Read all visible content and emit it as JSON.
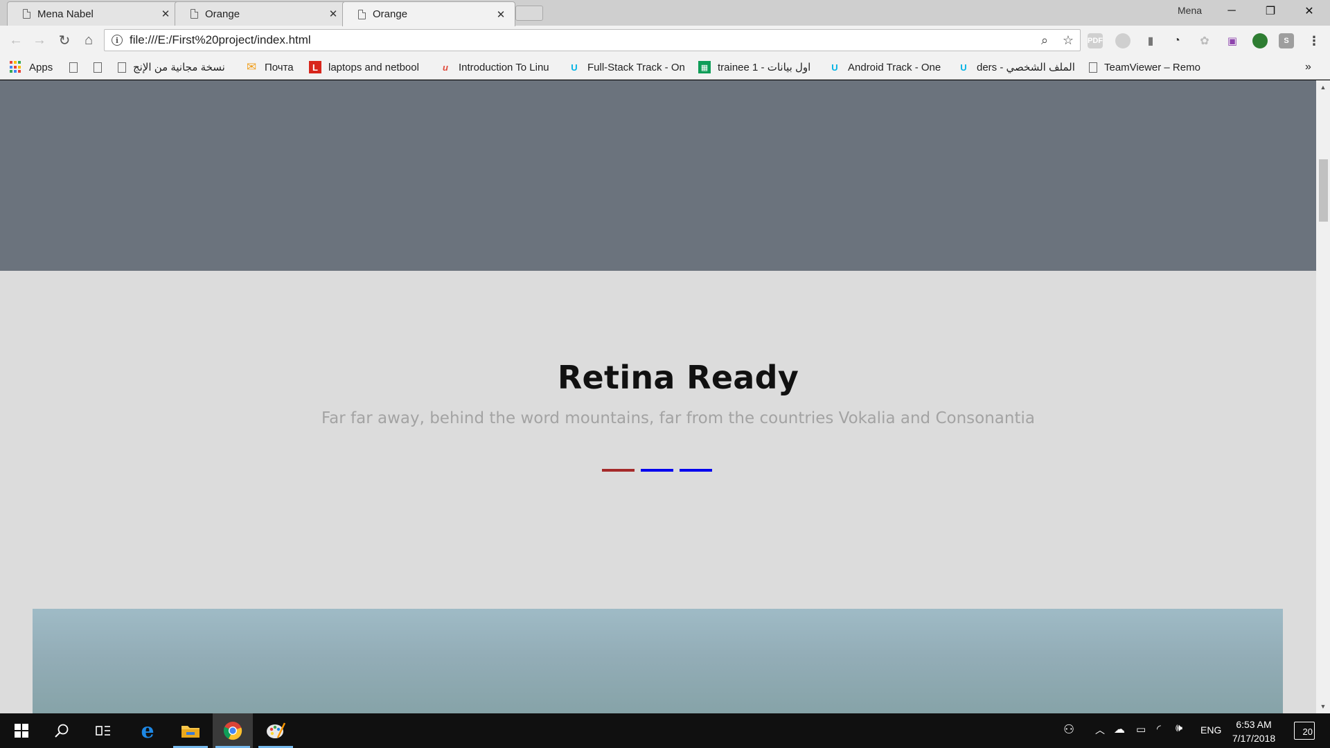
{
  "browser": {
    "tabs": [
      {
        "title": "Mena Nabel",
        "active": false
      },
      {
        "title": "Orange",
        "active": false
      },
      {
        "title": "Orange",
        "active": true
      }
    ],
    "profile_name": "Mena",
    "address": "file:///E:/First%20project/index.html",
    "bookmarks": [
      {
        "label": "Apps",
        "icon": "apps-grid-icon"
      },
      {
        "label": "",
        "icon": "page-icon"
      },
      {
        "label": "",
        "icon": "page-icon"
      },
      {
        "label": "نسخة مجانية من الإنج",
        "icon": "page-icon"
      },
      {
        "label": "Почта",
        "icon": "mail-icon",
        "color": "#f0a020"
      },
      {
        "label": "laptops and netbool",
        "icon": "letter-l-icon",
        "color": "#d8261c"
      },
      {
        "label": "Introduction To Linu",
        "icon": "udemy-icon",
        "color": "#e0493a"
      },
      {
        "label": "Full-Stack Track - On",
        "icon": "udacity-icon",
        "color": "#02b3e4"
      },
      {
        "label": "trainee 1 - اول بيانات",
        "icon": "sheets-icon",
        "color": "#0f9d58"
      },
      {
        "label": "Android Track - One",
        "icon": "udacity-icon",
        "color": "#02b3e4"
      },
      {
        "label": "الملف الشخصي - ders",
        "icon": "udacity-icon",
        "color": "#02b3e4"
      },
      {
        "label": "TeamViewer – Remo",
        "icon": "page-icon"
      }
    ],
    "more_bookmarks": "»"
  },
  "page": {
    "section": {
      "title": "Retina Ready",
      "subtitle": "Far far away, behind the word mountains, far from the countries Vokalia and Consonantia",
      "divider_colors": [
        "#a52a2a",
        "#0000ee",
        "#0000ee"
      ]
    },
    "colors": {
      "hero_band": "#6b737d",
      "background": "#dcdcdc"
    }
  },
  "taskbar": {
    "language": "ENG",
    "time": "6:53 AM",
    "date": "7/17/2018",
    "notification_count": "20"
  }
}
